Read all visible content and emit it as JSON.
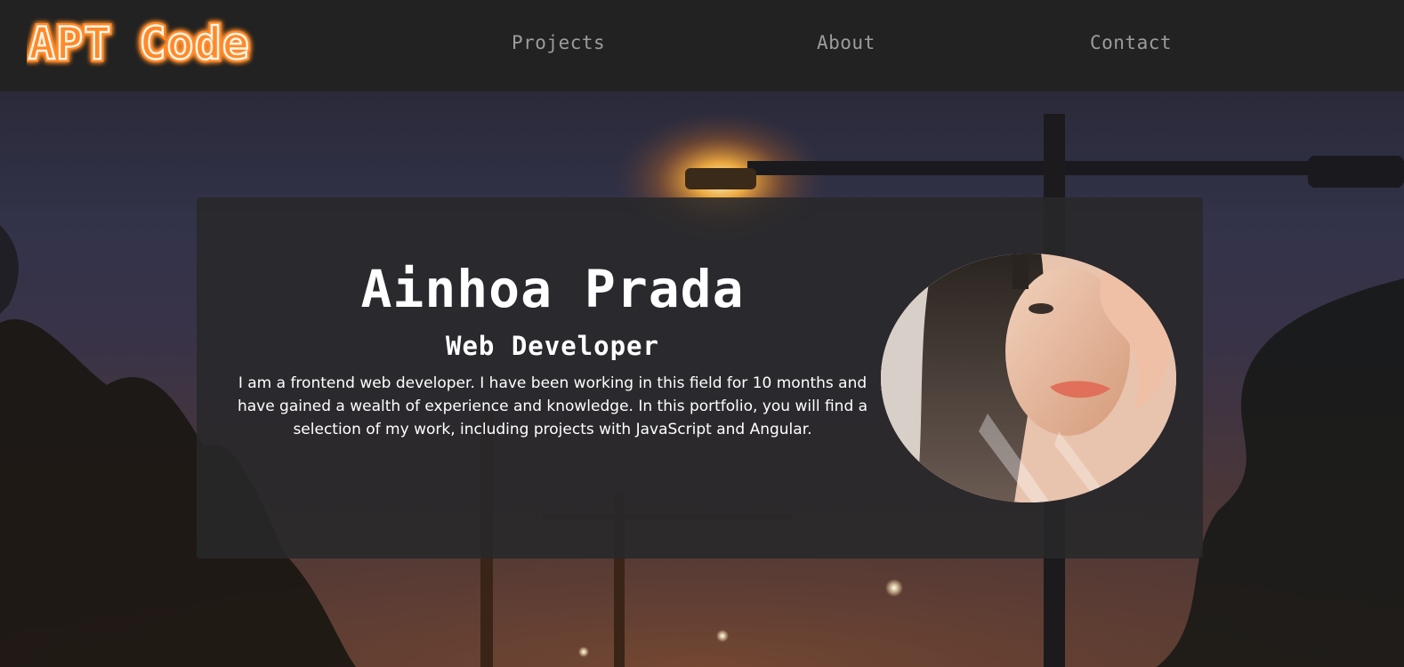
{
  "header": {
    "logo_text": "APT Code",
    "nav": [
      {
        "label": "Projects"
      },
      {
        "label": "About"
      },
      {
        "label": "Contact"
      }
    ]
  },
  "hero": {
    "name": "Ainhoa Prada",
    "role": "Web Developer",
    "bio": "I am a frontend web developer. I have been working in this field for 10 months and have gained a wealth of experience and knowledge. In this portfolio, you will find a selection of my work, including projects with JavaScript and Angular."
  },
  "colors": {
    "header_bg": "#222222",
    "nav_text": "#9c9c9c",
    "logo_glow": "#ff8a2a",
    "card_bg": "#28282a",
    "text": "#ffffff"
  }
}
